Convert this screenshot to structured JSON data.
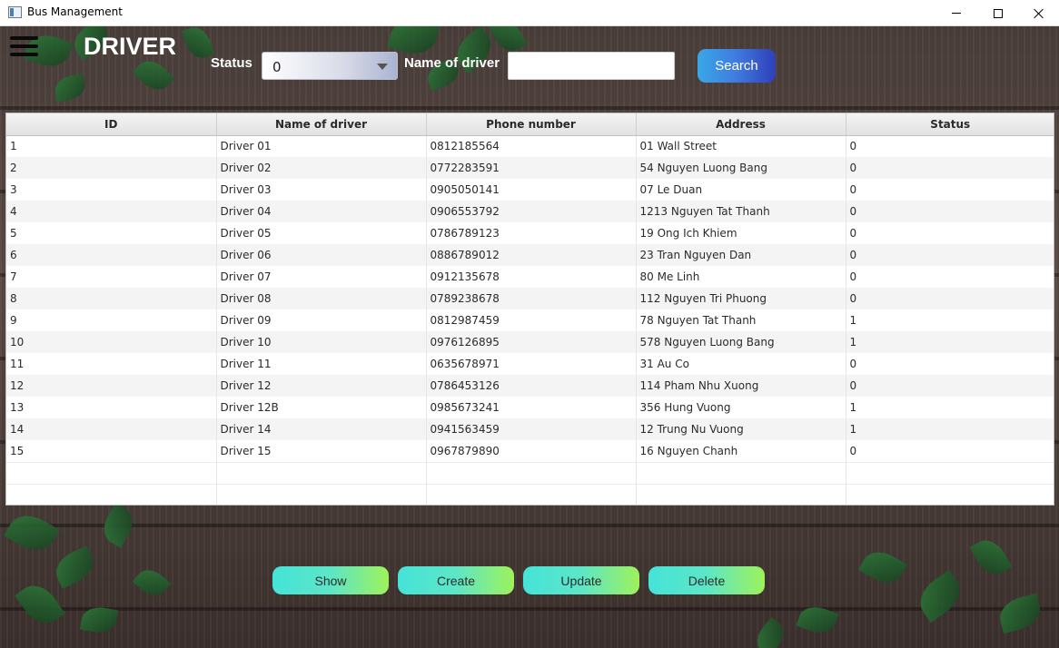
{
  "window": {
    "title": "Bus Management"
  },
  "header": {
    "title": "DRIVER",
    "status_label": "Status",
    "status_value": "0",
    "name_label": "Name of driver",
    "name_value": "",
    "search_label": "Search"
  },
  "table": {
    "columns": [
      "ID",
      "Name of driver",
      "Phone number",
      "Address",
      "Status"
    ],
    "rows": [
      [
        "1",
        "Driver 01",
        "0812185564",
        "01 Wall Street",
        "0"
      ],
      [
        "2",
        "Driver 02",
        "0772283591",
        "54 Nguyen Luong Bang",
        "0"
      ],
      [
        "3",
        "Driver 03",
        "0905050141",
        "07 Le Duan",
        "0"
      ],
      [
        "4",
        "Driver 04",
        "0906553792",
        "1213 Nguyen Tat Thanh",
        "0"
      ],
      [
        "5",
        "Driver 05",
        "0786789123",
        "19 Ong Ich Khiem",
        "0"
      ],
      [
        "6",
        "Driver 06",
        "0886789012",
        "23 Tran Nguyen Dan",
        "0"
      ],
      [
        "7",
        "Driver 07",
        "0912135678",
        "80 Me Linh",
        "0"
      ],
      [
        "8",
        "Driver 08",
        "0789238678",
        "112 Nguyen Tri Phuong",
        "0"
      ],
      [
        "9",
        "Driver 09",
        "0812987459",
        "78 Nguyen Tat Thanh",
        "1"
      ],
      [
        "10",
        "Driver 10",
        "0976126895",
        "578 Nguyen Luong Bang",
        "1"
      ],
      [
        "11",
        "Driver 11",
        "0635678971",
        "31 Au Co",
        "0"
      ],
      [
        "12",
        "Driver 12",
        "0786453126",
        "114 Pham Nhu Xuong",
        "0"
      ],
      [
        "13",
        "Driver 12B",
        "0985673241",
        "356 Hung Vuong",
        "1"
      ],
      [
        "14",
        "Driver 14",
        "0941563459",
        "12 Trung Nu Vuong",
        "1"
      ],
      [
        "15",
        "Driver 15",
        "0967879890",
        "16 Nguyen Chanh",
        "0"
      ]
    ]
  },
  "actions": {
    "show": "Show",
    "create": "Create",
    "update": "Update",
    "delete": "Delete"
  }
}
